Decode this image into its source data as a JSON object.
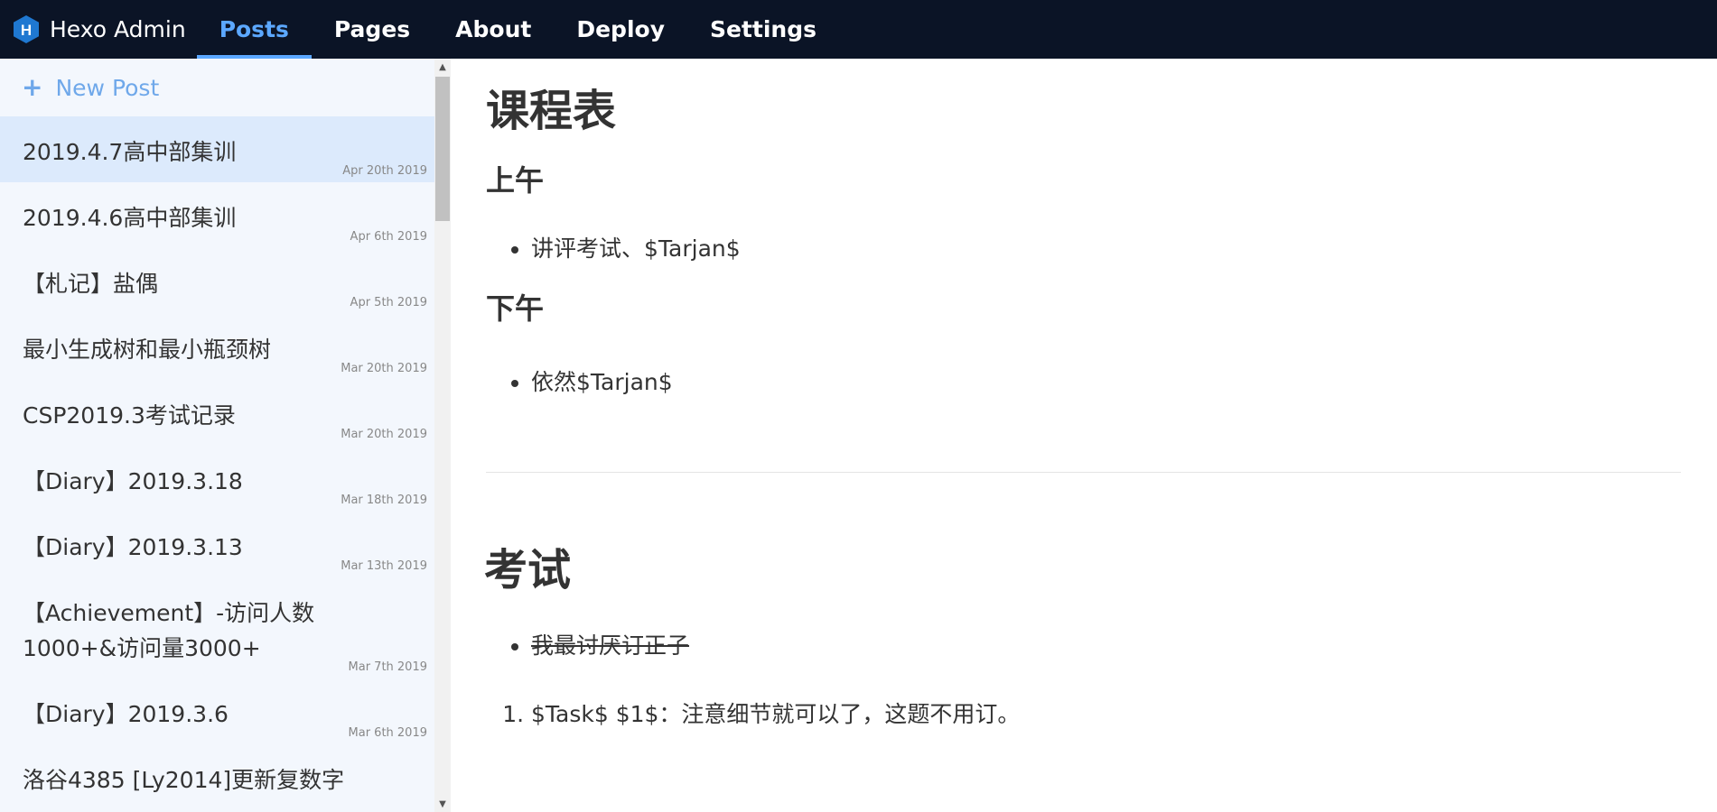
{
  "nav": {
    "brand": "Hexo Admin",
    "items": [
      {
        "label": "Posts",
        "active": true
      },
      {
        "label": "Pages",
        "active": false
      },
      {
        "label": "About",
        "active": false
      },
      {
        "label": "Deploy",
        "active": false
      },
      {
        "label": "Settings",
        "active": false
      }
    ]
  },
  "sidebar": {
    "new_post": "New Post",
    "posts": [
      {
        "title": "2019.4.7高中部集训",
        "date": "Apr 20th 2019",
        "selected": true
      },
      {
        "title": "2019.4.6高中部集训",
        "date": "Apr 6th 2019"
      },
      {
        "title": "【札记】盐偶",
        "date": "Apr 5th 2019"
      },
      {
        "title": "最小生成树和最小瓶颈树",
        "date": "Mar 20th 2019"
      },
      {
        "title": "CSP2019.3考试记录",
        "date": "Mar 20th 2019"
      },
      {
        "title": "【Diary】2019.3.18",
        "date": "Mar 18th 2019"
      },
      {
        "title": "【Diary】2019.3.13",
        "date": "Mar 13th 2019"
      },
      {
        "title": "【Achievement】-访问人数1000+&访问量3000+",
        "date": "Mar 7th 2019"
      },
      {
        "title": "【Diary】2019.3.6",
        "date": "Mar 6th 2019"
      },
      {
        "title": "洛谷4385 [Ly2014]更新复数字",
        "date": ""
      }
    ]
  },
  "content": {
    "h_schedule": "课程表",
    "h_morning": "上午",
    "morning_item": "讲评考试、$Tarjan$",
    "h_afternoon": "下午",
    "afternoon_item": "依然$Tarjan$",
    "h_exam": "考试",
    "exam_strike": "我最讨厌订正子",
    "exam_task1": "$Task$ $1$：注意细节就可以了，这题不用订。"
  },
  "colors": {
    "nav_bg": "#0b1426",
    "accent": "#5ca8ff",
    "sidebar_bg": "#f3f7fd",
    "selected_bg": "#dceafc"
  }
}
